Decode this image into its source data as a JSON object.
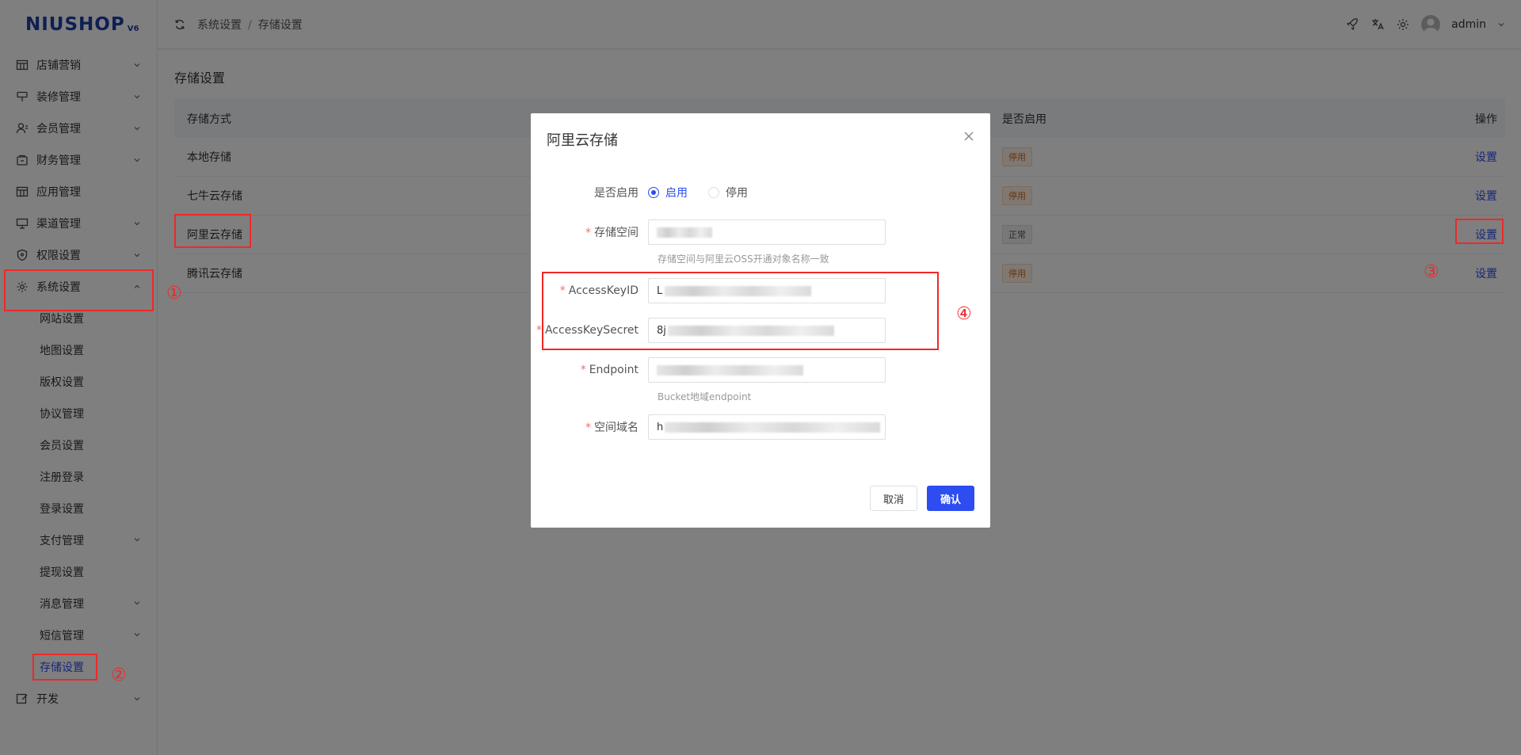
{
  "logo": {
    "text": "NIUSHOP",
    "version": "V6"
  },
  "sidebar": {
    "items": [
      {
        "label": "店铺营销"
      },
      {
        "label": "装修管理"
      },
      {
        "label": "会员管理"
      },
      {
        "label": "财务管理"
      },
      {
        "label": "应用管理"
      },
      {
        "label": "渠道管理"
      },
      {
        "label": "权限设置"
      },
      {
        "label": "系统设置"
      }
    ],
    "submenu": [
      {
        "label": "网站设置"
      },
      {
        "label": "地图设置"
      },
      {
        "label": "版权设置"
      },
      {
        "label": "协议管理"
      },
      {
        "label": "会员设置"
      },
      {
        "label": "注册登录"
      },
      {
        "label": "登录设置"
      },
      {
        "label": "支付管理"
      },
      {
        "label": "提现设置"
      },
      {
        "label": "消息管理"
      },
      {
        "label": "短信管理"
      },
      {
        "label": "存储设置"
      }
    ],
    "dev": {
      "label": "开发"
    }
  },
  "header": {
    "breadcrumb": [
      "系统设置",
      "存储设置"
    ],
    "separator": "/",
    "user": "admin"
  },
  "main": {
    "title": "存储设置",
    "table": {
      "headers": [
        "存储方式",
        "是否启用",
        "操作"
      ],
      "rows": [
        {
          "name": "本地存储",
          "status": "停用",
          "action": "设置"
        },
        {
          "name": "七牛云存储",
          "status": "停用",
          "action": "设置"
        },
        {
          "name": "阿里云存储",
          "status": "正常",
          "action": "设置"
        },
        {
          "name": "腾讯云存储",
          "status": "停用",
          "action": "设置"
        }
      ]
    }
  },
  "modal": {
    "title": "阿里云存储",
    "fields": {
      "enable_label": "是否启用",
      "enable_on": "启用",
      "enable_off": "停用",
      "bucket_label": "存储空间",
      "bucket_hint": "存储空间与阿里云OSS开通对象名称一致",
      "keyid_label": "AccessKeyID",
      "keyid_value": "L",
      "secret_label": "AccessKeySecret",
      "secret_value": "8j",
      "endpoint_label": "Endpoint",
      "endpoint_hint": "Bucket地域endpoint",
      "domain_label": "空间域名",
      "domain_value": "h"
    },
    "cancel": "取消",
    "confirm": "确认"
  },
  "annotations": [
    "①",
    "②",
    "③",
    "④"
  ],
  "colors": {
    "accent": "#2d4df0",
    "annotation": "#f02828",
    "logo": "#1f3fa8"
  }
}
